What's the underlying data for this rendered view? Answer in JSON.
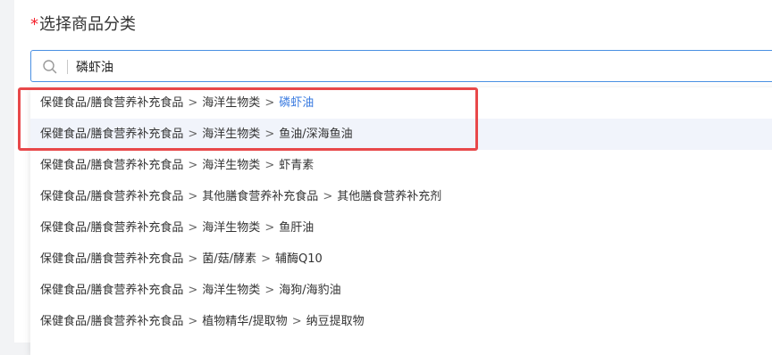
{
  "form": {
    "required_mark": "*",
    "label": "选择商品分类"
  },
  "search": {
    "value": "磷虾油",
    "icon": "search-icon"
  },
  "separator": ">",
  "options": [
    {
      "level1": "保健食品/膳食营养补充食品",
      "level2": "海洋生物类",
      "leaf": "磷虾油",
      "matched": true
    },
    {
      "level1": "保健食品/膳食营养补充食品",
      "level2": "海洋生物类",
      "leaf": "鱼油/深海鱼油",
      "hovered": true
    },
    {
      "level1": "保健食品/膳食营养补充食品",
      "level2": "海洋生物类",
      "leaf": "虾青素"
    },
    {
      "level1": "保健食品/膳食营养补充食品",
      "level2": "其他膳食营养补充食品",
      "leaf": "其他膳食营养补充剂"
    },
    {
      "level1": "保健食品/膳食营养补充食品",
      "level2": "海洋生物类",
      "leaf": "鱼肝油"
    },
    {
      "level1": "保健食品/膳食营养补充食品",
      "level2": "菌/菇/酵素",
      "leaf": "辅酶Q10"
    },
    {
      "level1": "保健食品/膳食营养补充食品",
      "level2": "海洋生物类",
      "leaf": "海狗/海豹油"
    },
    {
      "level1": "保健食品/膳食营养补充食品",
      "level2": "植物精华/提取物",
      "leaf": "纳豆提取物"
    }
  ],
  "colors": {
    "accent": "#3a7be0",
    "highlight_frame": "#e8484a",
    "required": "#f5222d"
  }
}
